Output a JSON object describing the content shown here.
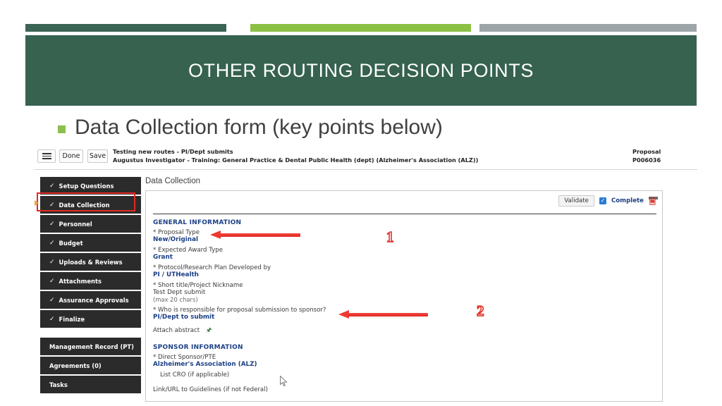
{
  "slide": {
    "title": "OTHER ROUTING DECISION POINTS",
    "bullet": "Data Collection form (key points below)",
    "colors": {
      "banner_green": "#36624F",
      "accent_green": "#8CC045",
      "accent_gray": "#9DA5A8",
      "annotation_red": "#EE3A32"
    }
  },
  "app": {
    "toolbar": {
      "menu_icon": "hamburger-icon",
      "done_label": "Done",
      "save_label": "Save",
      "doc_title": "Testing new routes - PI/Dept submits",
      "doc_subtitle": "Augustus Investigator - Training: General Practice & Dental Public Health (dept) (Alzheimer's Association (ALZ))",
      "proposal_label": "Proposal",
      "proposal_number": "P006036"
    },
    "sidebar": {
      "items": [
        {
          "label": "Setup Questions",
          "check": "✓",
          "done": true
        },
        {
          "label": "Data Collection",
          "check": "✓",
          "done": true,
          "highlighted": true
        },
        {
          "label": "Personnel",
          "check": "✓",
          "done": true
        },
        {
          "label": "Budget",
          "check": "✓",
          "done": true
        },
        {
          "label": "Uploads & Reviews",
          "check": "✓",
          "done": true
        },
        {
          "label": "Attachments",
          "check": "✓",
          "done": true
        },
        {
          "label": "Assurance Approvals",
          "check": "✓",
          "done": true
        },
        {
          "label": "Finalize",
          "check": "✓",
          "done": true
        }
      ],
      "secondary_items": [
        {
          "label": "Management Record (PT)"
        },
        {
          "label": "Agreements (0)"
        },
        {
          "label": "Tasks"
        }
      ]
    },
    "main": {
      "panel_title": "Data Collection",
      "validate_label": "Validate",
      "complete_label": "Complete",
      "complete_checked": true,
      "checkbox_glyph": "✓",
      "pdf_icon": "pdf-icon",
      "sections": [
        {
          "heading": "GENERAL INFORMATION",
          "fields": [
            {
              "label": "* Proposal Type",
              "value": "New/Original"
            },
            {
              "label": "* Expected Award Type",
              "value": "Grant"
            },
            {
              "label": "* Protocol/Research Plan Developed by",
              "value": "PI / UTHealth"
            },
            {
              "label": "* Short title/Project Nickname",
              "value": "Test Dept submit",
              "hint": "(max 20 chars)"
            },
            {
              "label": "* Who is responsible for proposal submission to sponsor?",
              "value": "PI/Dept to submit"
            }
          ],
          "attach_label": "Attach abstract",
          "attach_icon": "paperclip-icon"
        },
        {
          "heading": "SPONSOR INFORMATION",
          "fields": [
            {
              "label": "* Direct Sponsor/PTE",
              "value": "Alzheimer's Association (ALZ)"
            },
            {
              "label": "List CRO (if applicable)",
              "value": "",
              "indent": true
            },
            {
              "label": "Link/URL to Guidelines (if not Federal)",
              "value": ""
            }
          ]
        }
      ]
    }
  },
  "annotations": [
    {
      "number": "1",
      "points_to": "Proposal Type"
    },
    {
      "number": "2",
      "points_to": "Who is responsible for proposal submission to sponsor?"
    }
  ]
}
